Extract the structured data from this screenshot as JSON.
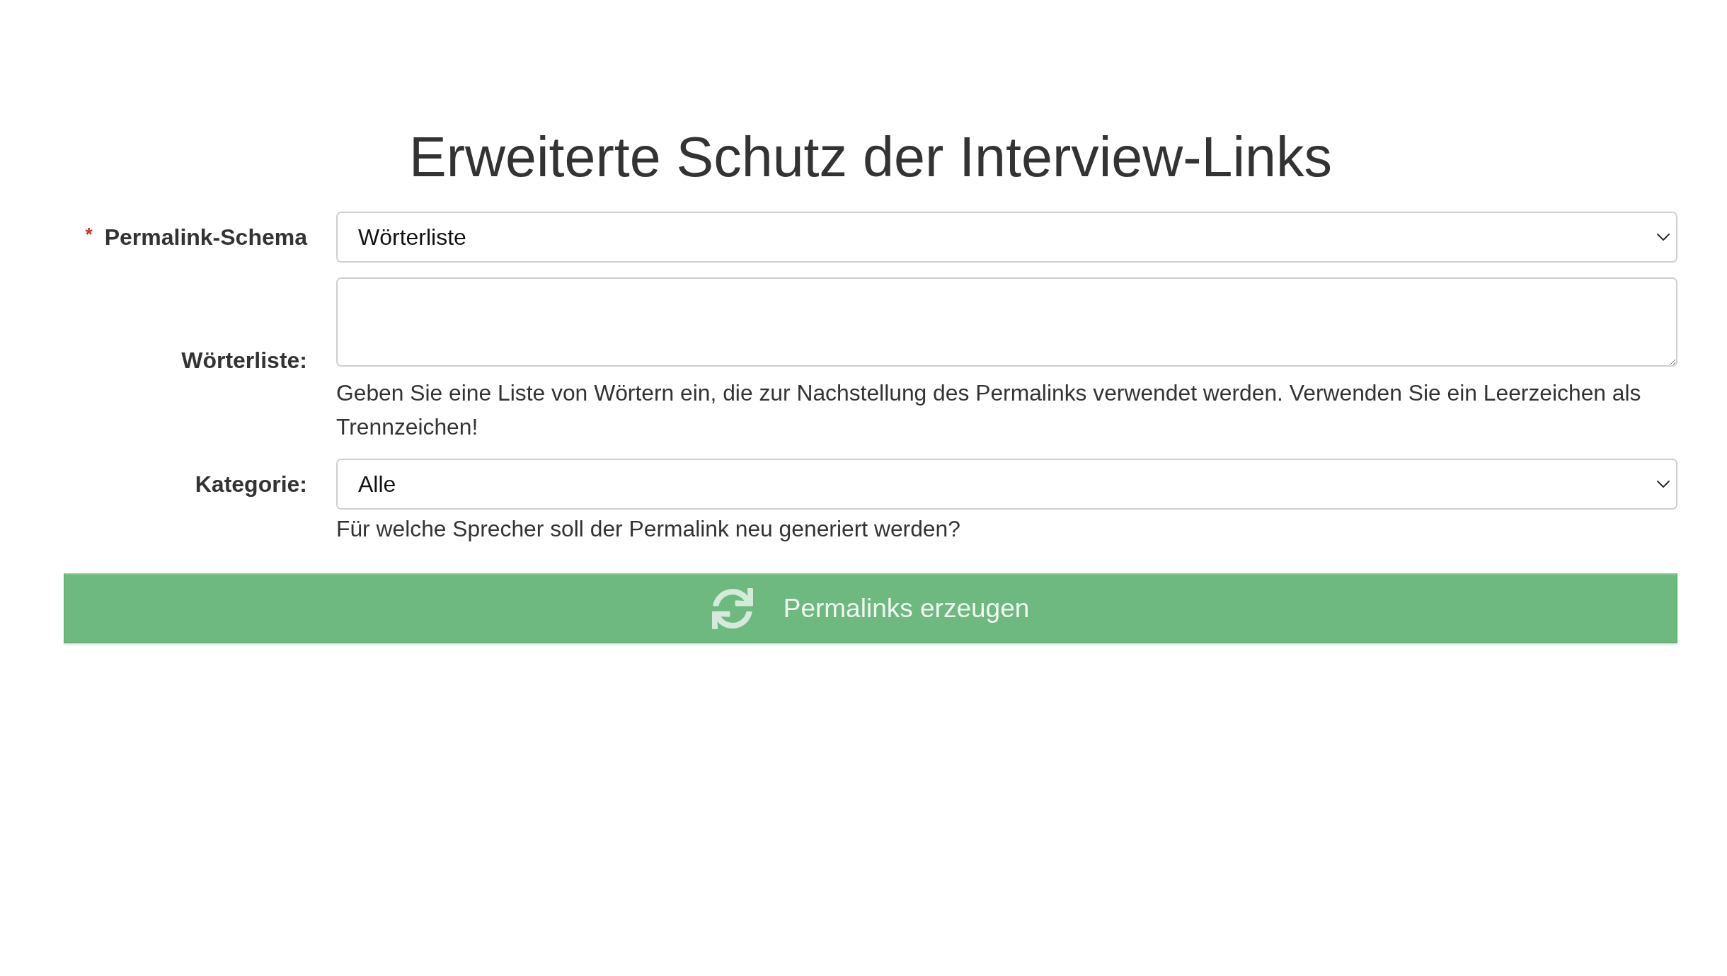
{
  "title": "Erweiterte Schutz der Interview-Links",
  "fields": [
    {
      "kind": "select",
      "required_mark": "*",
      "label": "Permalink-Schema",
      "value": "Wörterliste"
    },
    {
      "kind": "textarea",
      "label": "Wörterliste:",
      "help": "Geben Sie eine Liste von Wörtern ein, die zur Nachstellung des Permalinks verwendet werden. Verwenden Sie ein Leerzeichen als Trennzeichen!"
    },
    {
      "kind": "select",
      "label": "Kategorie:",
      "value": "Alle",
      "help": "Für welche Sprecher soll der Permalink neu generiert werden?"
    }
  ],
  "submit_button": {
    "label": "Permalinks erzeugen"
  }
}
